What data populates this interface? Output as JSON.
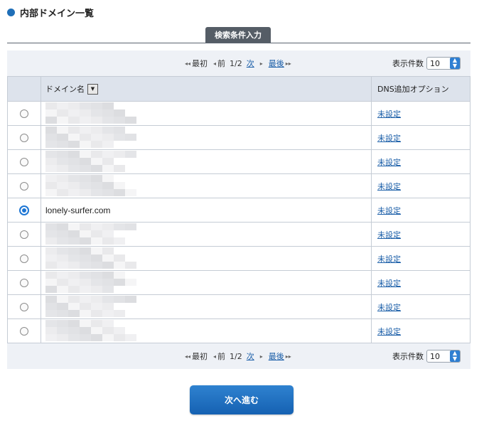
{
  "page": {
    "title": "内部ドメイン一覧"
  },
  "search_tab": {
    "label": "検索条件入力"
  },
  "pager": {
    "first": "最初",
    "prev": "前",
    "page": "1/2",
    "next": "次",
    "last": "最後",
    "per_page_label": "表示件数",
    "per_page_value": "10"
  },
  "table": {
    "headers": {
      "domain": "ドメイン名",
      "dns": "DNS追加オプション"
    },
    "rows": [
      {
        "domain": "",
        "dns": "未設定",
        "selected": false
      },
      {
        "domain": "",
        "dns": "未設定",
        "selected": false
      },
      {
        "domain": "",
        "dns": "未設定",
        "selected": false
      },
      {
        "domain": "",
        "dns": "未設定",
        "selected": false
      },
      {
        "domain": "lonely-surfer.com",
        "dns": "未設定",
        "selected": true
      },
      {
        "domain": "",
        "dns": "未設定",
        "selected": false
      },
      {
        "domain": "",
        "dns": "未設定",
        "selected": false
      },
      {
        "domain": "",
        "dns": "未設定",
        "selected": false
      },
      {
        "domain": "",
        "dns": "未設定",
        "selected": false
      },
      {
        "domain": "",
        "dns": "未設定",
        "selected": false
      }
    ]
  },
  "next_button": {
    "label": "次へ進む"
  },
  "colors": {
    "accent": "#1f6fb8",
    "link": "#1a5ea8",
    "panel": "#eef1f6",
    "tab": "#555d66"
  }
}
